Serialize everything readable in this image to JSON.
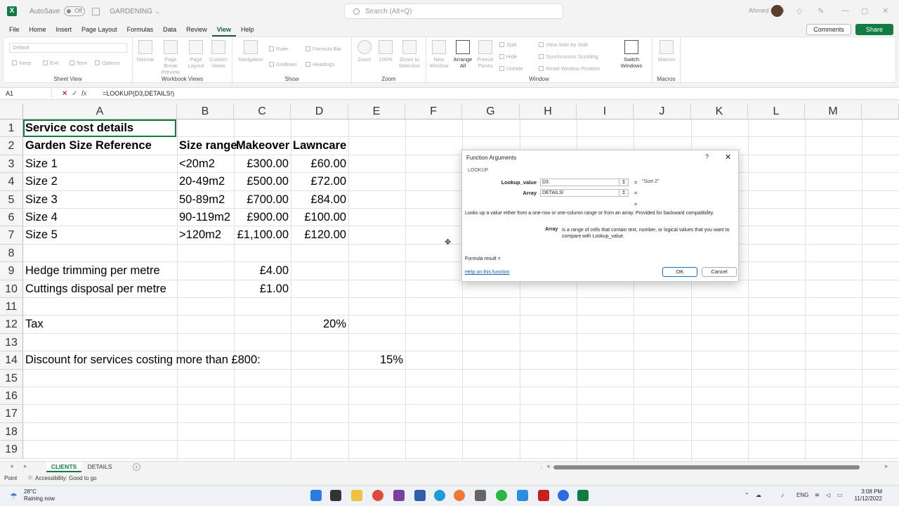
{
  "titlebar": {
    "autosave_label": "AutoSave",
    "autosave_state": "Off",
    "filename": "GARDENING",
    "search_placeholder": "Search (Alt+Q)",
    "user_name": "Ahmed Mufti"
  },
  "menu": {
    "items": [
      "File",
      "Home",
      "Insert",
      "Page Layout",
      "Formulas",
      "Data",
      "Review",
      "View",
      "Help"
    ],
    "active": "View",
    "comments_label": "Comments",
    "share_label": "Share"
  },
  "ribbon": {
    "sheet_view": {
      "label": "Sheet View",
      "select_value": "Default",
      "keep": "Keep",
      "exit": "Exit",
      "new": "New",
      "options": "Options"
    },
    "workbook_views": {
      "label": "Workbook Views",
      "normal": "Normal",
      "page_break": "Page Break Preview",
      "page_layout": "Page Layout",
      "custom_views": "Custom Views"
    },
    "show": {
      "label": "Show",
      "navigation": "Navigation",
      "ruler": "Ruler",
      "formula_bar": "Formula Bar",
      "gridlines": "Gridlines",
      "headings": "Headings"
    },
    "zoom": {
      "label": "Zoom",
      "zoom": "Zoom",
      "hundred": "100%",
      "zoom_selection": "Zoom to Selection"
    },
    "window": {
      "label": "Window",
      "new_window": "New Window",
      "arrange_all": "Arrange All",
      "freeze_panes": "Freeze Panes",
      "split": "Split",
      "hide": "Hide",
      "unhide": "Unhide",
      "side_by_side": "View Side by Side",
      "sync_scroll": "Synchronous Scrolling",
      "reset_position": "Reset Window Position",
      "switch_windows": "Switch Windows"
    },
    "macros": {
      "label": "Macros",
      "macros": "Macros"
    }
  },
  "formula_bar": {
    "name_box": "A1",
    "formula": "=LOOKUP(D3,DETAILS!)"
  },
  "columns": [
    "A",
    "B",
    "C",
    "D",
    "E",
    "F",
    "G",
    "H",
    "I",
    "J",
    "K",
    "L",
    "M"
  ],
  "rows": [
    "1",
    "2",
    "3",
    "4",
    "5",
    "6",
    "7",
    "8",
    "9",
    "10",
    "11",
    "12",
    "13",
    "14",
    "15",
    "16",
    "17",
    "18",
    "19"
  ],
  "cells": {
    "a1": "Service cost details",
    "a2": "Garden Size Reference",
    "b2": "Size range",
    "c2": "Makeover",
    "d2": "Lawncare",
    "a3": "Size 1",
    "b3": "<20m2",
    "c3": "£300.00",
    "d3": "£60.00",
    "a4": "Size 2",
    "b4": "20-49m2",
    "c4": "£500.00",
    "d4": "£72.00",
    "a5": "Size 3",
    "b5": "50-89m2",
    "c5": "£700.00",
    "d5": "£84.00",
    "a6": "Size 4",
    "b6": "90-119m2",
    "c6": "£900.00",
    "d6": "£100.00",
    "a7": "Size 5",
    "b7": ">120m2",
    "c7": "£1,100.00",
    "d7": "£120.00",
    "a9": "Hedge trimming per metre",
    "c9": "£4.00",
    "a10": "Cuttings disposal per metre",
    "c10": "£1.00",
    "a12": "Tax",
    "d12": "20%",
    "a14": "Discount for services costing more than £800:",
    "e14": "15%"
  },
  "dialog": {
    "title": "Function Arguments",
    "help_glyph": "?",
    "close_glyph": "✕",
    "function_name": "LOOKUP",
    "arg1_label": "Lookup_value",
    "arg1_value": "D3",
    "arg1_result": "\"Size 2\"",
    "arg2_label": "Array",
    "arg2_value": "DETAILS!",
    "arg2_result": "",
    "eq": "=",
    "description": "Looks up a value either from a one-row or one-column range or from an array. Provided for backward compatibility.",
    "arg_help_name": "Array",
    "arg_help_text": "is a range of cells that contain text, number, or logical values that you want to compare with Lookup_value.",
    "formula_result": "Formula result =",
    "help_link": "Help on this function",
    "ok": "OK",
    "cancel": "Cancel"
  },
  "sheets": {
    "tabs": [
      "CLIENTS",
      "DETAILS"
    ],
    "active": "CLIENTS"
  },
  "status": {
    "mode": "Point",
    "accessibility": "Accessibility: Good to go"
  },
  "taskbar": {
    "temperature": "28°C",
    "weather": "Raining now",
    "language": "ENG",
    "time": "3:08 PM",
    "date": "11/12/2022"
  },
  "colors": {
    "accent": "#107c41",
    "dialog_link": "#0563c1"
  }
}
